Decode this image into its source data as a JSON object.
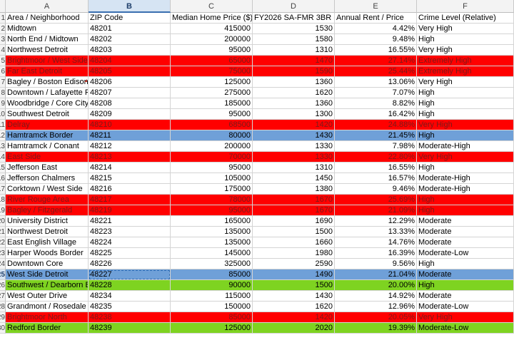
{
  "columns": [
    "A",
    "B",
    "C",
    "D",
    "E",
    "F"
  ],
  "selected_column": "B",
  "colors": {
    "red": "#ff0000",
    "blue": "#6fa0d8",
    "green": "#7ed321"
  },
  "rows": [
    {
      "num": "1",
      "cells": [
        "Area / Neighborhood",
        "ZIP Code",
        "Median Home Price ($)",
        "FY2026 SA-FMR 3BR ($)",
        "Annual Rent / Price",
        "Crime Level (Relative)"
      ],
      "fill": ""
    },
    {
      "num": "2",
      "cells": [
        "Midtown",
        "48201",
        "415000",
        "1530",
        "4.42%",
        "Very High"
      ],
      "fill": ""
    },
    {
      "num": "3",
      "cells": [
        "North End / Midtown",
        "48202",
        "200000",
        "1580",
        "9.48%",
        "High"
      ],
      "fill": ""
    },
    {
      "num": "4",
      "cells": [
        "Northwest Detroit",
        "48203",
        "95000",
        "1310",
        "16.55%",
        "Very High"
      ],
      "fill": ""
    },
    {
      "num": "5",
      "cells": [
        "Brightmoor / West Side",
        "48204",
        "65000",
        "1470",
        "27.14%",
        "Extremely High"
      ],
      "fill": "red"
    },
    {
      "num": "6",
      "cells": [
        "Far East Detroit",
        "48205",
        "75000",
        "1590",
        "25.44%",
        "Extremely High"
      ],
      "fill": "red"
    },
    {
      "num": "7",
      "cells": [
        "Bagley / Boston Edison",
        "48206",
        "125000",
        "1360",
        "13.06%",
        "Very High"
      ],
      "fill": ""
    },
    {
      "num": "8",
      "cells": [
        "Downtown / Lafayette P",
        "48207",
        "275000",
        "1620",
        "7.07%",
        "High"
      ],
      "fill": ""
    },
    {
      "num": "9",
      "cells": [
        "Woodbridge / Core City",
        "48208",
        "185000",
        "1360",
        "8.82%",
        "High"
      ],
      "fill": ""
    },
    {
      "num": "10",
      "cells": [
        "Southwest Detroit",
        "48209",
        "95000",
        "1300",
        "16.42%",
        "High"
      ],
      "fill": ""
    },
    {
      "num": "11",
      "cells": [
        "Delray",
        "48210",
        "68500",
        "1420",
        "24.88%",
        "Very High"
      ],
      "fill": "red"
    },
    {
      "num": "12",
      "cells": [
        "Hamtramck Border",
        "48211",
        "80000",
        "1430",
        "21.45%",
        "High"
      ],
      "fill": "blue"
    },
    {
      "num": "13",
      "cells": [
        "Hamtramck / Conant",
        "48212",
        "200000",
        "1330",
        "7.98%",
        "Moderate-High"
      ],
      "fill": ""
    },
    {
      "num": "14",
      "cells": [
        "East Side",
        "48213",
        "70000",
        "1330",
        "22.80%",
        "Very High"
      ],
      "fill": "red"
    },
    {
      "num": "15",
      "cells": [
        "Jefferson East",
        "48214",
        "95000",
        "1310",
        "16.55%",
        "High"
      ],
      "fill": ""
    },
    {
      "num": "16",
      "cells": [
        "Jefferson Chalmers",
        "48215",
        "105000",
        "1450",
        "16.57%",
        "Moderate-High"
      ],
      "fill": ""
    },
    {
      "num": "17",
      "cells": [
        "Corktown / West Side",
        "48216",
        "175000",
        "1380",
        "9.46%",
        "Moderate-High"
      ],
      "fill": ""
    },
    {
      "num": "18",
      "cells": [
        "River Rouge Area",
        "48217",
        "78000",
        "1670",
        "25.69%",
        "High"
      ],
      "fill": "red"
    },
    {
      "num": "19",
      "cells": [
        "Bagley / Fitzgerald",
        "48219",
        "95000",
        "1670",
        "21.09%",
        "High"
      ],
      "fill": "red"
    },
    {
      "num": "20",
      "cells": [
        "University District",
        "48221",
        "165000",
        "1690",
        "12.29%",
        "Moderate"
      ],
      "fill": ""
    },
    {
      "num": "21",
      "cells": [
        "Northwest Detroit",
        "48223",
        "135000",
        "1500",
        "13.33%",
        "Moderate"
      ],
      "fill": ""
    },
    {
      "num": "22",
      "cells": [
        "East English Village",
        "48224",
        "135000",
        "1660",
        "14.76%",
        "Moderate"
      ],
      "fill": ""
    },
    {
      "num": "23",
      "cells": [
        "Harper Woods Border",
        "48225",
        "145000",
        "1980",
        "16.39%",
        "Moderate-Low"
      ],
      "fill": ""
    },
    {
      "num": "24",
      "cells": [
        "Downtown Core",
        "48226",
        "325000",
        "2590",
        "9.56%",
        "High"
      ],
      "fill": ""
    },
    {
      "num": "25",
      "cells": [
        "West Side Detroit",
        "48227",
        "85000",
        "1490",
        "21.04%",
        "Moderate"
      ],
      "fill": "blue",
      "selected": true
    },
    {
      "num": "26",
      "cells": [
        "Southwest / Dearborn B",
        "48228",
        "90000",
        "1500",
        "20.00%",
        "High"
      ],
      "fill": "green"
    },
    {
      "num": "27",
      "cells": [
        "West Outer Drive",
        "48234",
        "115000",
        "1430",
        "14.92%",
        "Moderate"
      ],
      "fill": ""
    },
    {
      "num": "28",
      "cells": [
        "Grandmont / Rosedale",
        "48235",
        "150000",
        "1620",
        "12.96%",
        "Moderate-Low"
      ],
      "fill": ""
    },
    {
      "num": "29",
      "cells": [
        "Brightmoor North",
        "48238",
        "85000",
        "1420",
        "20.05%",
        "Very High"
      ],
      "fill": "red"
    },
    {
      "num": "30",
      "cells": [
        "Redford Border",
        "48239",
        "125000",
        "2020",
        "19.39%",
        "Moderate-Low"
      ],
      "fill": "green"
    }
  ]
}
